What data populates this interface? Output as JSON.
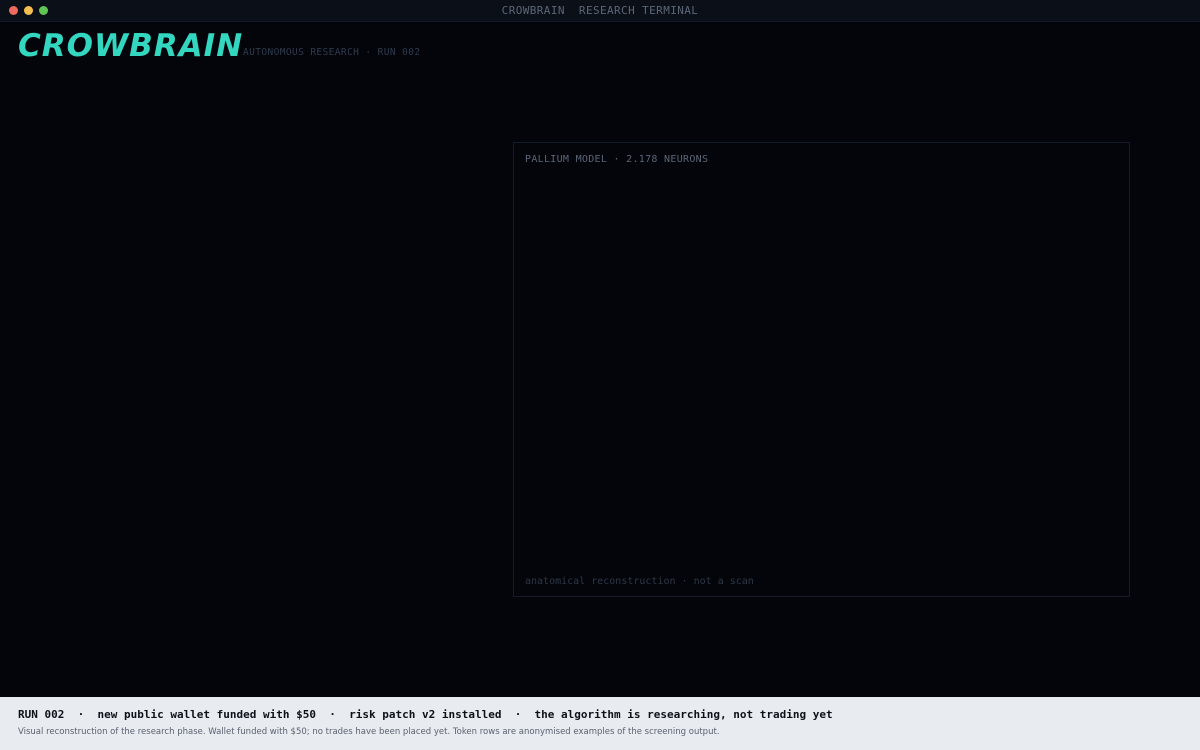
{
  "window": {
    "title": "CROWBRAIN  RESEARCH TERMINAL",
    "controls": [
      {
        "name": "close",
        "color": "#ed6a5e"
      },
      {
        "name": "minimize",
        "color": "#f5bf4f"
      },
      {
        "name": "zoom",
        "color": "#61c554"
      }
    ]
  },
  "header": {
    "logo": "CROWBRAIN",
    "subtitle": "AUTONOMOUS RESEARCH · RUN 002",
    "accent_color": "#33d6bf"
  },
  "panel": {
    "title": "PALLIUM MODEL · 2.178 NEURONS",
    "footnote": "anatomical reconstruction · not a scan"
  },
  "footer": {
    "status": "RUN 002  ·  new public wallet funded with $50  ·  risk patch v2 installed  ·  the algorithm is researching, not trading yet",
    "note": "Visual reconstruction of the research phase. Wallet funded with $50; no trades have been placed yet. Token rows are anonymised examples of the screening output."
  }
}
